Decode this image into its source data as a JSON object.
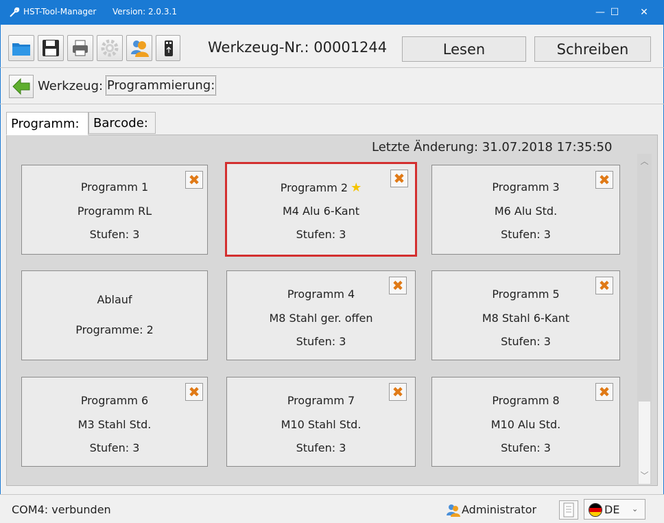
{
  "window": {
    "app_name": "HST-Tool-Manager",
    "version": "Version: 2.0.3.1",
    "minimize_glyph": "—",
    "maximize_glyph": "☐",
    "close_glyph": "✕",
    "accent_color": "#1a7ad4"
  },
  "toolbar": {
    "buttons": [
      {
        "name": "open-folder",
        "icon": "folder-icon"
      },
      {
        "name": "save",
        "icon": "floppy-disk-icon"
      },
      {
        "name": "print",
        "icon": "printer-icon"
      },
      {
        "name": "settings",
        "icon": "gear-icon"
      },
      {
        "name": "users",
        "icon": "users-icon"
      },
      {
        "name": "usb",
        "icon": "usb-drive-icon"
      }
    ],
    "tool_number": "Werkzeug-Nr.: 00001244",
    "read_label": "Lesen",
    "write_label": "Schreiben"
  },
  "breadcrumb": {
    "parent": "Werkzeug:",
    "current": "Programmierung:"
  },
  "tabs": [
    {
      "label": "Programm:",
      "active": true
    },
    {
      "label": "Barcode:",
      "active": false
    }
  ],
  "content": {
    "last_change": "Letzte Änderung:  31.07.2018  17:35:50",
    "cards": [
      {
        "line1": "Programm 1",
        "line2": "Programm RL",
        "line3": "Stufen: 3",
        "deletable": true,
        "selected": false,
        "favorite": false
      },
      {
        "line1": "Programm 2",
        "line2": "M4 Alu 6-Kant",
        "line3": "Stufen: 3",
        "deletable": true,
        "selected": true,
        "favorite": true
      },
      {
        "line1": "Programm 3",
        "line2": "M6 Alu Std.",
        "line3": "Stufen: 3",
        "deletable": true,
        "selected": false,
        "favorite": false
      },
      {
        "line1": "Ablauf",
        "line2": "Programme: 2",
        "line3": "",
        "deletable": false,
        "selected": false,
        "favorite": false
      },
      {
        "line1": "Programm 4",
        "line2": "M8 Stahl ger. offen",
        "line3": "Stufen: 3",
        "deletable": true,
        "selected": false,
        "favorite": false
      },
      {
        "line1": "Programm 5",
        "line2": "M8 Stahl 6-Kant",
        "line3": "Stufen: 3",
        "deletable": true,
        "selected": false,
        "favorite": false
      },
      {
        "line1": "Programm 6",
        "line2": "M3 Stahl Std.",
        "line3": "Stufen: 3",
        "deletable": true,
        "selected": false,
        "favorite": false
      },
      {
        "line1": "Programm 7",
        "line2": "M10 Stahl Std.",
        "line3": "Stufen: 3",
        "deletable": true,
        "selected": false,
        "favorite": false
      },
      {
        "line1": "Programm 8",
        "line2": "M10 Alu Std.",
        "line3": "Stufen: 3",
        "deletable": true,
        "selected": false,
        "favorite": false
      }
    ],
    "delete_glyph": "✖",
    "favorite_glyph": "★",
    "selection_color": "#d32f2f",
    "delete_color": "#e07a17"
  },
  "status": {
    "connection": "COM4: verbunden",
    "user": "Administrator",
    "language": "DE"
  }
}
